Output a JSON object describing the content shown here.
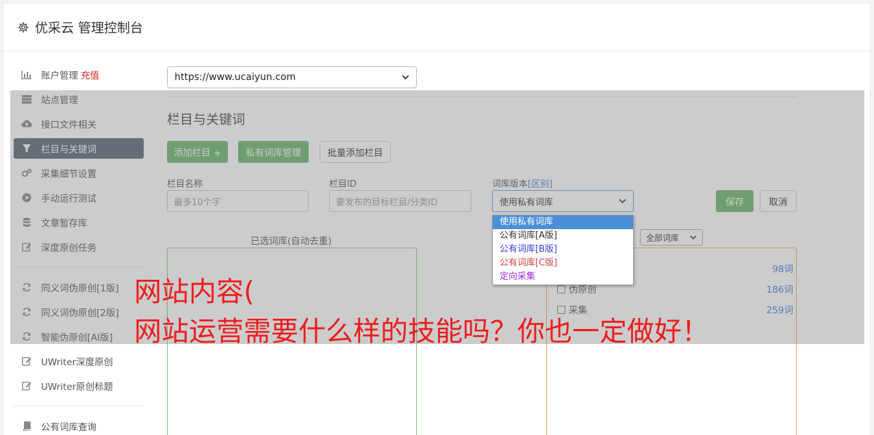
{
  "header": {
    "title": "优采云 管理控制台"
  },
  "sidebar": {
    "items": [
      {
        "label": "账户管理",
        "badge": "充值",
        "icon": "bar-chart-icon"
      },
      {
        "label": "站点管理",
        "icon": "server-icon"
      },
      {
        "label": "接口文件相关",
        "icon": "cloud-upload-icon"
      },
      {
        "label": "栏目与关键词",
        "icon": "filter-icon",
        "active": true
      },
      {
        "label": "采集细节设置",
        "icon": "gears-icon"
      },
      {
        "label": "手动运行测试",
        "icon": "play-circle-icon"
      },
      {
        "label": "文章暂存库",
        "icon": "database-icon"
      },
      {
        "label": "深度原创任务",
        "icon": "edit-icon"
      },
      {
        "label": "同义词伪原创[1版]",
        "icon": "refresh-icon"
      },
      {
        "label": "同义词伪原创[2版]",
        "icon": "refresh-icon"
      },
      {
        "label": "智能伪原创[AI版]",
        "icon": "refresh-icon"
      },
      {
        "label": "UWriter深度原创",
        "icon": "edit-icon"
      },
      {
        "label": "UWriter原创标题",
        "icon": "edit-icon"
      },
      {
        "label": "公有词库查询",
        "icon": "book-icon"
      }
    ]
  },
  "site_select": {
    "value": "https://www.ucaiyun.com"
  },
  "section": {
    "title": "栏目与关键词"
  },
  "buttons": {
    "add_column": "添加栏目 +",
    "private_lib": "私有词库管理",
    "batch_add": "批量添加栏目",
    "save": "保存",
    "cancel": "取消"
  },
  "form": {
    "column_name_label": "栏目名称",
    "column_name_placeholder": "最多10个字",
    "column_id_label": "栏目ID",
    "column_id_placeholder": "要发布的目标栏目/分类ID",
    "lib_version_label": "词库版本",
    "lib_version_link": "[区别]",
    "lib_version_value": "使用私有词库"
  },
  "dropdown": {
    "options": [
      {
        "label": "使用私有词库",
        "color": "#ffffff"
      },
      {
        "label": "公有词库[A版]",
        "color": "#333333"
      },
      {
        "label": "公有词库[B版]",
        "color": "#3a3ad0"
      },
      {
        "label": "公有词库[C版]",
        "color": "#d04040"
      },
      {
        "label": "定向采集",
        "color": "#9b30d0"
      }
    ]
  },
  "selected_box": {
    "title": "已选词库(自动去重)"
  },
  "all_libs_select": {
    "value": "全部词库"
  },
  "libs": [
    {
      "name": "",
      "count": "98词"
    },
    {
      "name": "伪原创",
      "count": "186词"
    },
    {
      "name": "采集",
      "count": "259词"
    }
  ],
  "overlay_text": {
    "line1": "网站内容(",
    "line2": "网站运营需要什么样的技能吗？你也一定做好！"
  },
  "colors": {
    "accent_green": "#6ab56b",
    "active_sidebar": "#5a6674",
    "link_blue": "#3b7ddd",
    "overlay_red": "#ee1c1c"
  }
}
